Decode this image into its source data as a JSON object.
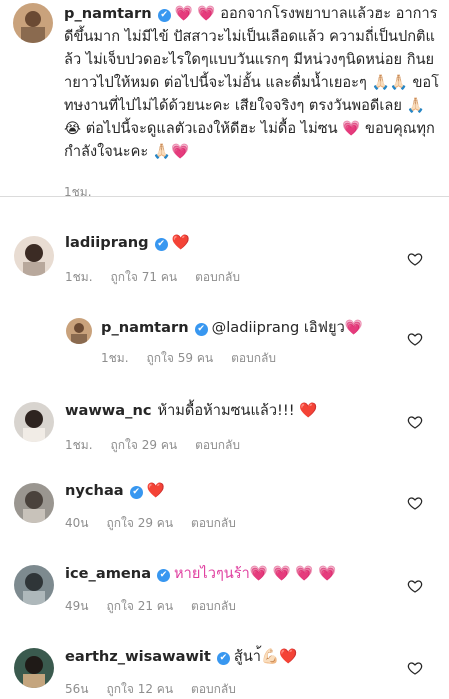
{
  "caption": {
    "username": "p_namtarn",
    "text": "💗 💗 ออกจากโรงพยาบาลแล้วฮะ อาการดีขึ้นมาก ไม่มีไข้ ปัสสาวะไม่เป็นเลือดแล้ว ความถี่เป็นปกติแล้ว ไม่เจ็บปวดอะไรใดๆแบบวันแรกๆ มีหน่วงๆนิดหน่อย กินยายาวไปให้หมด ต่อไปนี้จะไม่อั้น และดื่มน้ำเยอะๆ 🙏🏻🙏🏻 ขอโทษงานที่ไปไม่ได้ด้วยนะคะ เสียใจจริงๆ ตรงวันพอดีเลย 🙏🏻😭 ต่อไปนี้จะดูแลตัวเองให้ดีฮะ ไม่ดื้อ ไม่ซน 💗 ขอบคุณทุกกำลังใจนะคะ 🙏🏻💗",
    "time": "1ชม."
  },
  "comments": [
    {
      "username": "ladiiprang",
      "verified": true,
      "text": "❤️",
      "time": "1ชม.",
      "likes": "ถูกใจ 71 คน",
      "reply": "ตอบกลับ"
    },
    {
      "username": "p_namtarn",
      "verified": true,
      "text": "@ladiiprang เอิฟยูว💗",
      "time": "1ชม.",
      "likes": "ถูกใจ 59 คน",
      "reply": "ตอบกลับ"
    },
    {
      "username": "wawwa_nc",
      "verified": false,
      "text": "ห้ามดื้อห้ามซนแล้ว!!! ❤️",
      "time": "1ชม.",
      "likes": "ถูกใจ 29 คน",
      "reply": "ตอบกลับ"
    },
    {
      "username": "nychaa",
      "verified": true,
      "text": "❤️",
      "time": "40น",
      "likes": "ถูกใจ 29 คน",
      "reply": "ตอบกลับ"
    },
    {
      "username": "ice_amena",
      "verified": true,
      "text": "หายไวๆนร้า💗 💗 💗 💗",
      "time": "49น",
      "likes": "ถูกใจ 21 คน",
      "reply": "ตอบกลับ"
    },
    {
      "username": "earthz_wisawawit",
      "verified": true,
      "text": "สู้นา้💪🏻❤️",
      "time": "56น",
      "likes": "ถูกใจ 12 คน",
      "reply": "ตอบกลับ"
    }
  ],
  "colors": {
    "verified": "#3897f0",
    "heart": "#ed4956",
    "meta": "#8e8e8e",
    "divider": "#dbdbdb"
  },
  "icons": {
    "like": "heart-outline-icon",
    "verified": "verified-badge-icon"
  }
}
